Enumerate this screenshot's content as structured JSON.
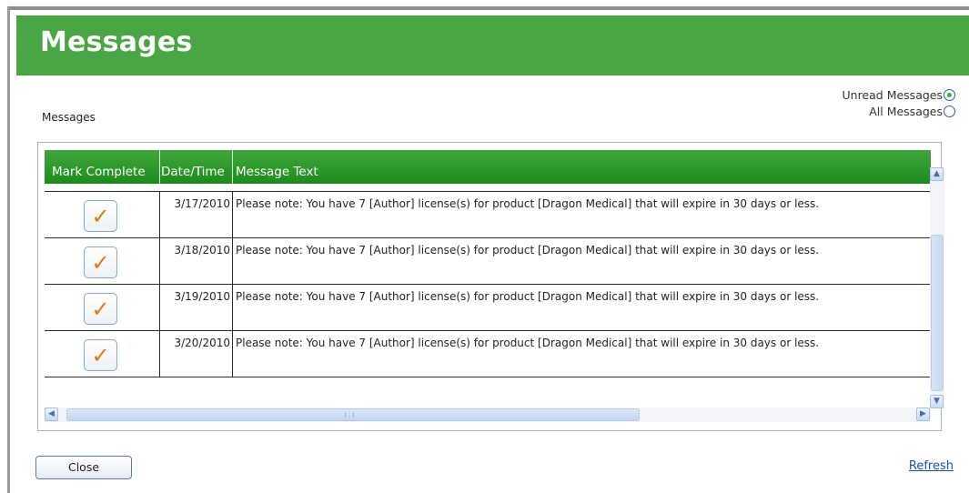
{
  "header": {
    "title": "Messages"
  },
  "section_label": "Messages",
  "filters": {
    "unread_label": "Unread Messages",
    "all_label": "All Messages",
    "selected": "unread"
  },
  "grid": {
    "columns": [
      "Mark Complete",
      "Date/Time",
      "Message Text"
    ],
    "rows": [
      {
        "date": "3/17/2010",
        "text": "Please note: You have 7 [Author] license(s) for product [Dragon Medical] that will expire in 30 days or less."
      },
      {
        "date": "3/18/2010",
        "text": "Please note: You have 7 [Author] license(s) for product [Dragon Medical] that will expire in 30 days or less."
      },
      {
        "date": "3/19/2010",
        "text": "Please note: You have 7 [Author] license(s) for product [Dragon Medical] that will expire in 30 days or less."
      },
      {
        "date": "3/20/2010",
        "text": "Please note: You have 7 [Author] license(s) for product [Dragon Medical] that will expire in 30 days or less."
      }
    ]
  },
  "footer": {
    "close_label": "Close",
    "refresh_label": "Refresh"
  },
  "colors": {
    "header_green": "#4aa544",
    "grid_header_green": "#2a962a",
    "check_orange": "#e07a10",
    "link_blue": "#1a4fa8"
  },
  "icons": {
    "check": "checkmark-icon",
    "unread_radio": "radio-selected-icon",
    "all_radio": "radio-empty-icon"
  }
}
